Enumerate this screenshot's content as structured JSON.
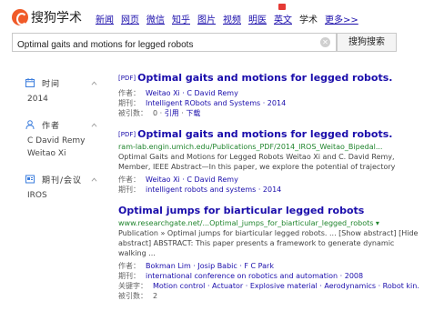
{
  "logo_text": "搜狗学术",
  "nav": [
    "新闻",
    "网页",
    "微信",
    "知乎",
    "图片",
    "视频",
    "明医",
    "英文",
    "学术",
    "更多>>"
  ],
  "search": {
    "value": "Optimal gaits and motions for legged robots",
    "button": "搜狗搜索"
  },
  "filters": [
    {
      "label": "时间",
      "icon": "calendar-icon",
      "items": [
        "2014"
      ]
    },
    {
      "label": "作者",
      "icon": "person-icon",
      "items": [
        "C David Remy",
        "Weitao Xi"
      ]
    },
    {
      "label": "期刊/会议",
      "icon": "journal-icon",
      "items": [
        "IROS"
      ]
    }
  ],
  "results": [
    {
      "tag": "[PDF]",
      "title": "Optimal gaits and motions for legged robots.",
      "author_key": "作者：",
      "authors": "Weitao Xi · C David Remy",
      "journal_key": "期刊：",
      "journal": "Intelligent RObots and Systems · 2014",
      "cited_key": "被引数：",
      "cited": "0",
      "cite_link": "引用",
      "download_link": "下载"
    },
    {
      "tag": "[PDF]",
      "title": "Optimal gaits and motions for legged robots.",
      "url": "ram-lab.engin.umich.edu/Publications_PDF/2014_IROS_Weitao_Bipedal...",
      "snippet": "Optimal Gaits and Motions for Legged Robots Weitao Xi and C. David Remy, Member, IEEE Abstract—In this paper, we explore the potential of trajectory",
      "author_key": "作者：",
      "authors": "Weitao Xi · C David Remy",
      "journal_key": "期刊：",
      "journal": "intelligent robots and systems · 2014"
    },
    {
      "title": "Optimal jumps for biarticular legged robots",
      "url": "www.researchgate.net/...Optimal_jumps_for_biarticular_legged_robots ▾",
      "snippet": "Publication » Optimal jumps for biarticular legged robots. ... [Show abstract] [Hide abstract] ABSTRACT: This paper presents a framework to generate dynamic walking ...",
      "author_key": "作者：",
      "authors": "Bokman Lim · Josip Babic · F C Park",
      "journal_key": "期刊：",
      "journal": "international conference on robotics and automation · 2008",
      "keywords_key": "关键字：",
      "keywords": "Motion control · Actuator · Explosive material · Aerodynamics · Robot kin...",
      "cited_key": "被引数：",
      "cited": "2"
    }
  ]
}
